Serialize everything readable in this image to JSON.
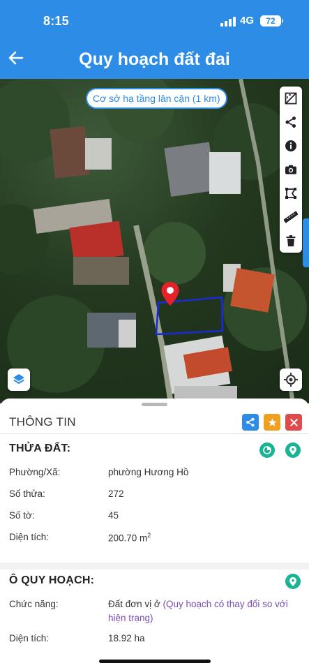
{
  "status_bar": {
    "time": "8:15",
    "network": "4G",
    "battery": "72"
  },
  "header": {
    "title": "Quy hoạch đất đai",
    "back_icon": "arrow-left-icon"
  },
  "map": {
    "chip_label": "Cơ sở hạ tầng lân cận (1 km)",
    "tools": [
      "layer-compare-icon",
      "share-icon",
      "info-icon",
      "camera-icon",
      "polygon-icon",
      "ruler-icon",
      "trash-icon"
    ],
    "marker": "map-pin-icon",
    "parcel_outline_color": "#1b2bd6"
  },
  "panel": {
    "title": "THÔNG TIN",
    "actions": {
      "share_color": "#2e8ce6",
      "star_color": "#f0a020",
      "close_color": "#e14a4a"
    },
    "parcel": {
      "heading": "THỬA ĐẤT:",
      "rows": [
        {
          "label": "Phường/Xã:",
          "value": "phường Hương Hồ"
        },
        {
          "label": "Số thửa:",
          "value": "272"
        },
        {
          "label": "Số tờ:",
          "value": "45"
        },
        {
          "label": "Diện tích:",
          "value": "200.70 m",
          "unit_sup": "2"
        }
      ]
    },
    "planning": {
      "heading": "Ô QUY HOẠCH:",
      "function_label": "Chức năng:",
      "function_value": "Đất đơn vị ở",
      "function_note_line1": "(Quy hoạch có thay đổi so với",
      "function_note_line2": "hiện trạng)",
      "area_label": "Diện tích:",
      "area_value": "18.92 ha"
    }
  },
  "colors": {
    "primary": "#2c8ce6",
    "accent_green": "#1ab394",
    "marker_red": "#e8202a"
  }
}
